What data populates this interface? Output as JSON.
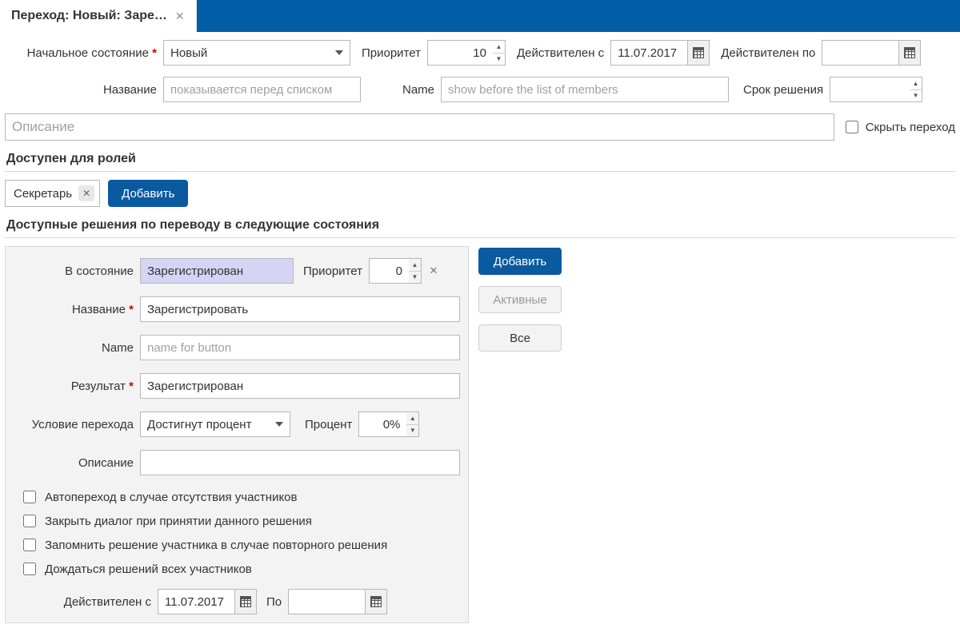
{
  "tab": {
    "title": "Переход: Новый: Заре…"
  },
  "form": {
    "labels": {
      "initial_state": "Начальное состояние",
      "priority": "Приоритет",
      "valid_from": "Действителен с",
      "valid_to": "Действителен по",
      "title_ru": "Название",
      "name_en": "Name",
      "deadline": "Срок решения",
      "description": "Описание",
      "hide_transition": "Скрыть переход"
    },
    "initial_state": "Новый",
    "priority": "10",
    "valid_from": "11.07.2017",
    "valid_to": "",
    "title_ru_placeholder": "показывается перед списком",
    "name_en_placeholder": "show before the list of members",
    "deadline_value": "",
    "description_placeholder": "Описание",
    "hide_transition_checked": false
  },
  "roles": {
    "header": "Доступен для ролей",
    "items": [
      "Секретарь"
    ],
    "add_button": "Добавить"
  },
  "decisions": {
    "header": "Доступные решения по переводу в следующие состояния",
    "side": {
      "add": "Добавить",
      "active": "Активные",
      "all": "Все"
    },
    "item": {
      "labels": {
        "to_state": "В состояние",
        "priority": "Приоритет",
        "title_ru": "Название",
        "name_en": "Name",
        "result": "Результат",
        "condition": "Условие перехода",
        "percent": "Процент",
        "description": "Описание",
        "valid_from": "Действителен с",
        "valid_to_short": "По"
      },
      "to_state": "Зарегистрирован",
      "priority": "0",
      "title_ru": "Зарегистрировать",
      "name_en_placeholder": "name for button",
      "result": "Зарегистрирован",
      "condition": "Достигнут процент",
      "percent": "0%",
      "description": "",
      "checkboxes": {
        "auto_transition": "Автопереход в случае отсутствия участников",
        "close_dialog": "Закрыть диалог при принятии данного решения",
        "remember_decision": "Запомнить решение участника в случае повторного решения",
        "wait_all": "Дождаться решений всех участников"
      },
      "valid_from": "11.07.2017",
      "valid_to": ""
    }
  }
}
